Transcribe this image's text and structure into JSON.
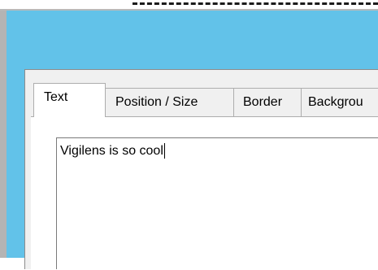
{
  "dialog": {
    "tabs": [
      {
        "label": "Text",
        "active": true
      },
      {
        "label": "Position / Size",
        "active": false
      },
      {
        "label": "Border",
        "active": false
      },
      {
        "label": "Backgrou",
        "active": false
      }
    ],
    "text_field": {
      "value": "Vigilens is so cool"
    }
  },
  "colors": {
    "canvas_background": "#62c2e9",
    "dialog_background": "#f0f0f0",
    "tab_active_background": "#ffffff",
    "border": "#adadad"
  }
}
